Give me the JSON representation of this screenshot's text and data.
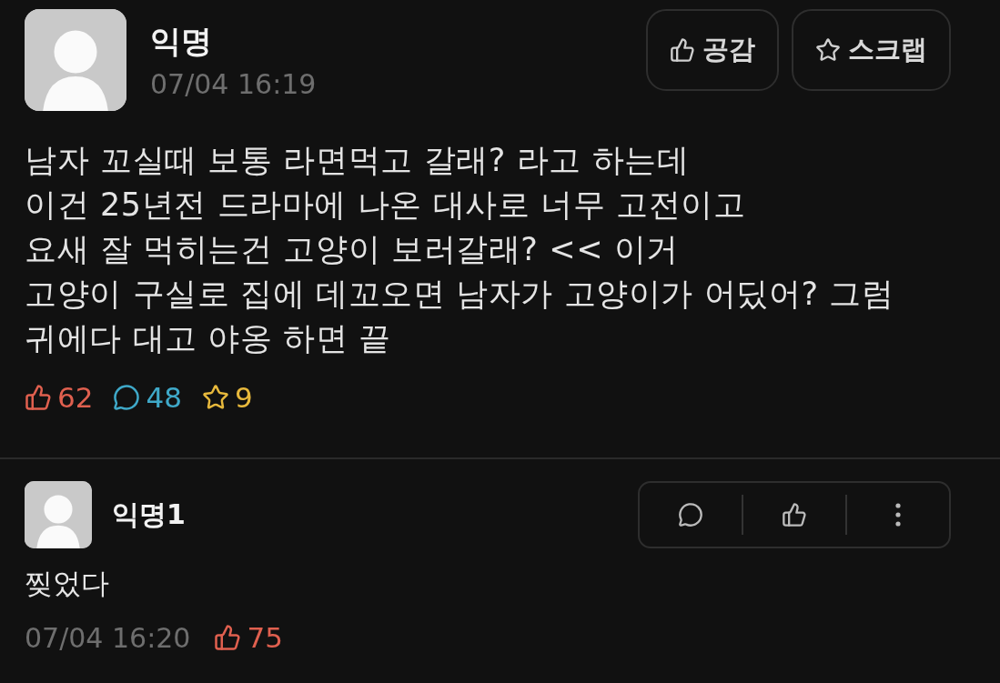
{
  "post": {
    "author": "익명",
    "time": "07/04 16:19",
    "buttons": [
      {
        "kind": "like",
        "label": "공감"
      },
      {
        "kind": "scrap",
        "label": "스크랩"
      }
    ],
    "body": "남자 꼬실때 보통 라면먹고 갈래? 라고 하는데\n이건 25년전 드라마에 나온 대사로 너무 고전이고\n요새 잘 먹히는건 고양이 보러갈래? << 이거\n고양이 구실로 집에 데꼬오면 남자가 고양이가 어딨어? 그럼\n귀에다 대고 야옹 하면 끝",
    "stats": [
      {
        "kind": "like",
        "count": "62",
        "color": "#e0604f"
      },
      {
        "kind": "comment",
        "count": "48",
        "color": "#3fa9c9"
      },
      {
        "kind": "scrap",
        "count": "9",
        "color": "#e8b93c"
      }
    ]
  },
  "comments": [
    {
      "author": "익명1",
      "text": "찢었다",
      "time": "07/04 16:20",
      "likes": "75",
      "actions": [
        {
          "kind": "reply"
        },
        {
          "kind": "like"
        },
        {
          "kind": "more"
        }
      ]
    }
  ]
}
